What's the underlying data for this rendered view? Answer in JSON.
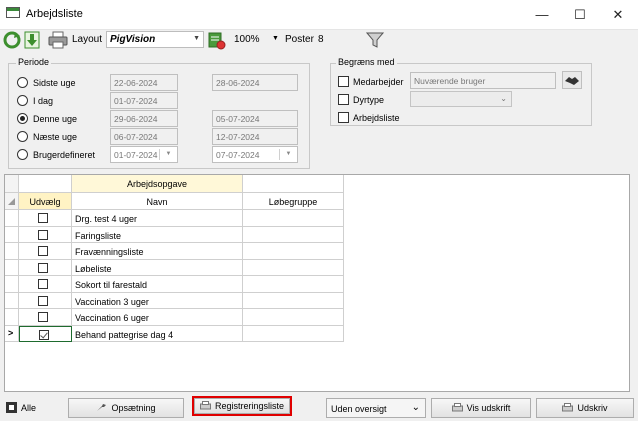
{
  "window": {
    "title": "Arbejdsliste",
    "minimize": "—",
    "maximize": "☐",
    "close": "✕"
  },
  "toolbar": {
    "layout_label": "Layout",
    "layout_value": "PigVision",
    "zoom_value": "100%",
    "poster_label": "Poster",
    "poster_value": "8"
  },
  "periode": {
    "title": "Periode",
    "options": [
      {
        "label": "Sidste uge",
        "from": "22-06-2024",
        "to": "28-06-2024",
        "selected": false
      },
      {
        "label": "I dag",
        "from": "01-07-2024",
        "to": "",
        "selected": false
      },
      {
        "label": "Denne uge",
        "from": "29-06-2024",
        "to": "05-07-2024",
        "selected": true
      },
      {
        "label": "Næste uge",
        "from": "06-07-2024",
        "to": "12-07-2024",
        "selected": false
      },
      {
        "label": "Brugerdefineret",
        "from": "01-07-2024",
        "to": "07-07-2024",
        "selected": false
      }
    ]
  },
  "filter": {
    "title": "Begræns med",
    "medarbejder_label": "Medarbejder",
    "medarbejder_value": "Nuværende bruger",
    "dyrtype_label": "Dyrtype",
    "dyrtype_value": "",
    "arbejdsliste_label": "Arbejdsliste"
  },
  "grid": {
    "group_header": "Arbejdsopgave",
    "col_select": "Udvælg",
    "col_name": "Navn",
    "col_group": "Løbegruppe",
    "current_row_marker": ">",
    "rows": [
      {
        "name": "Drg. test 4 uger",
        "checked": false
      },
      {
        "name": "Faringsliste",
        "checked": false
      },
      {
        "name": "Fravænningsliste",
        "checked": false
      },
      {
        "name": "Løbeliste",
        "checked": false
      },
      {
        "name": "Sokort til farestald",
        "checked": false
      },
      {
        "name": "Vaccination 3 uger",
        "checked": false
      },
      {
        "name": "Vaccination 6 uger",
        "checked": false
      },
      {
        "name": "Behand pattegrise dag 4",
        "checked": true
      }
    ]
  },
  "bottom": {
    "alle_label": "Alle",
    "opsaetning_label": "Opsætning",
    "registrering_label": "Registreringsliste",
    "oversigt_value": "Uden oversigt",
    "vis_udskrift_label": "Vis udskrift",
    "udskriv_label": "Udskriv"
  },
  "colors": {
    "highlight_border": "#e00000",
    "group_header_bg": "#fff8d8",
    "selected_cell_border": "#1e6b2e"
  }
}
